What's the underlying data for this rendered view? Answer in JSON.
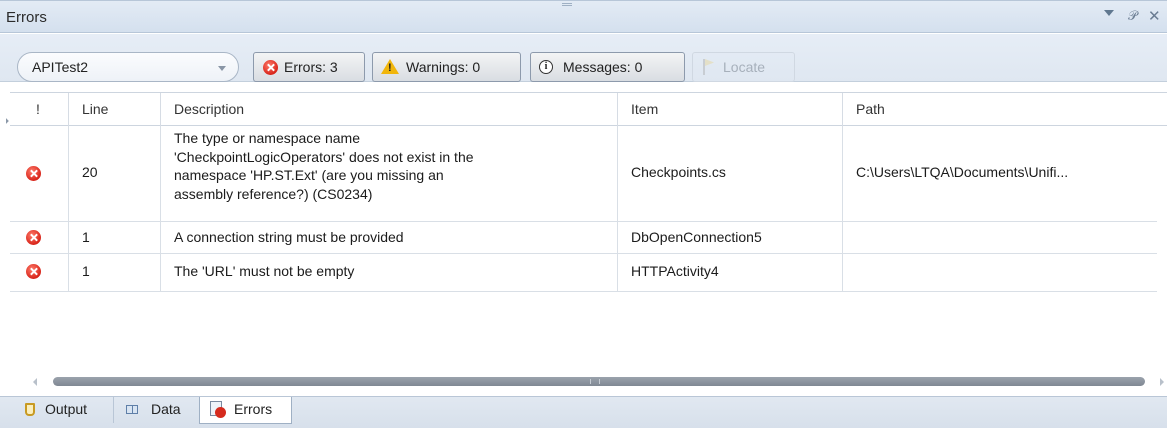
{
  "panel": {
    "title": "Errors"
  },
  "toolbar": {
    "project_value": "APITest2",
    "errors_label": "Errors: 3",
    "warnings_label": "Warnings: 0",
    "messages_label": "Messages: 0",
    "locate_label": "Locate"
  },
  "grid": {
    "columns": [
      "!",
      "Line",
      "Description",
      "Item",
      "Path"
    ],
    "rows": [
      {
        "severity": "error",
        "line": "20",
        "description": "The type or namespace name\n'CheckpointLogicOperators' does not exist in the\nnamespace 'HP.ST.Ext' (are you missing an\nassembly reference?) (CS0234)",
        "item": "Checkpoints.cs",
        "path": "C:\\Users\\LTQA\\Documents\\Unifi..."
      },
      {
        "severity": "error",
        "line": "1",
        "description": "A connection string must be provided",
        "item": "DbOpenConnection5",
        "path": ""
      },
      {
        "severity": "error",
        "line": "1",
        "description": "The 'URL' must not be empty",
        "item": "HTTPActivity4",
        "path": ""
      }
    ]
  },
  "tabs": [
    {
      "label": "Output",
      "icon": "output-icon"
    },
    {
      "label": "Data",
      "icon": "data-icon"
    },
    {
      "label": "Errors",
      "icon": "errors-tab-icon",
      "active": true
    }
  ],
  "colors": {
    "titlebar": "#d8e3f0",
    "error": "#d8251a",
    "warning": "#f1b60c"
  }
}
